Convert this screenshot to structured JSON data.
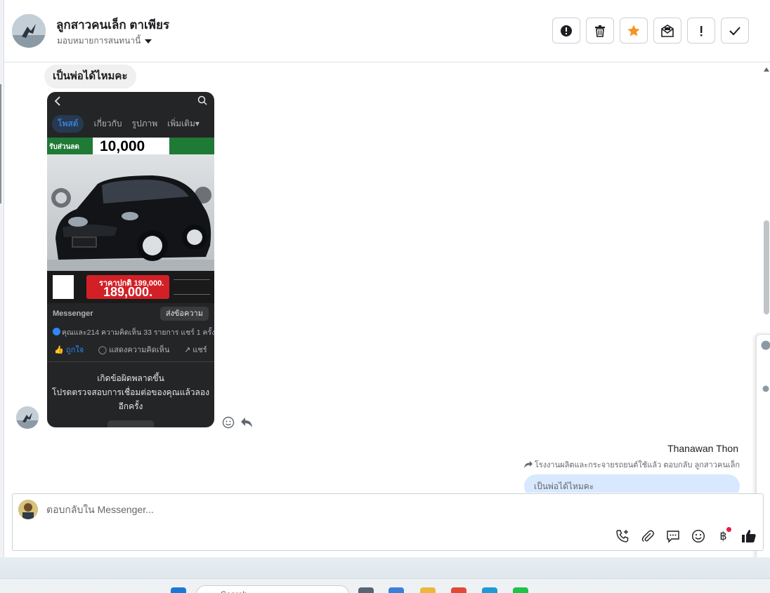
{
  "header": {
    "contact_name": "ลูกสาวคนเล็ก ตาเพียร",
    "assign_label": "มอบหมายการสนทนานี้",
    "actions": [
      {
        "name": "report-spam-icon"
      },
      {
        "name": "trash-icon"
      },
      {
        "name": "star-icon",
        "color": "#f7931e"
      },
      {
        "name": "mark-unread-icon"
      },
      {
        "name": "follow-up-icon"
      },
      {
        "name": "mark-done-icon"
      }
    ]
  },
  "chat": {
    "incoming_text": "เป็นพ่อได้ไหมคะ",
    "screenshot": {
      "tabs": [
        "โพสต์",
        "เกี่ยวกับ",
        "รูปภาพ",
        "เพิ่มเติม▾"
      ],
      "banner_left": "รับส่วนลด",
      "banner_amount": "10,000",
      "promo_line1": "ราคาปกติ 199,000.",
      "promo_price": "189,000.",
      "messenger_label": "Messenger",
      "send_message_label": "ส่งข้อความ",
      "stats": "คุณและ214  ความคิดเห็น 33 รายการ  แชร์ 1 ครั้ง",
      "like_label": "ถูกใจ",
      "comment_label": "แสดงความคิดเห็น",
      "share_label": "แชร์",
      "error_title": "เกิดข้อผิดพลาดขึ้น",
      "error_body": "โปรดตรวจสอบการเชื่อมต่อของคุณแล้วลองอีกครั้ง"
    },
    "agent_name": "Thanawan Thon",
    "reply_context": "โรงงานผลิตและกระจายรถยนต์ใช้แล้ว ตอบกลับ ลูกสาวคนเล็ก",
    "outgoing_preview": "เป็นพ่อได้ไหมคะ"
  },
  "composer": {
    "placeholder": "ตอบกลับใน Messenger...",
    "tools": [
      "phone-plus-icon",
      "paperclip-icon",
      "saved-reply-icon",
      "emoji-icon",
      "baht-icon",
      "thumbs-up-icon"
    ],
    "accent_color": "#1c1e21"
  },
  "taskbar": {
    "search_placeholder": "Search"
  }
}
